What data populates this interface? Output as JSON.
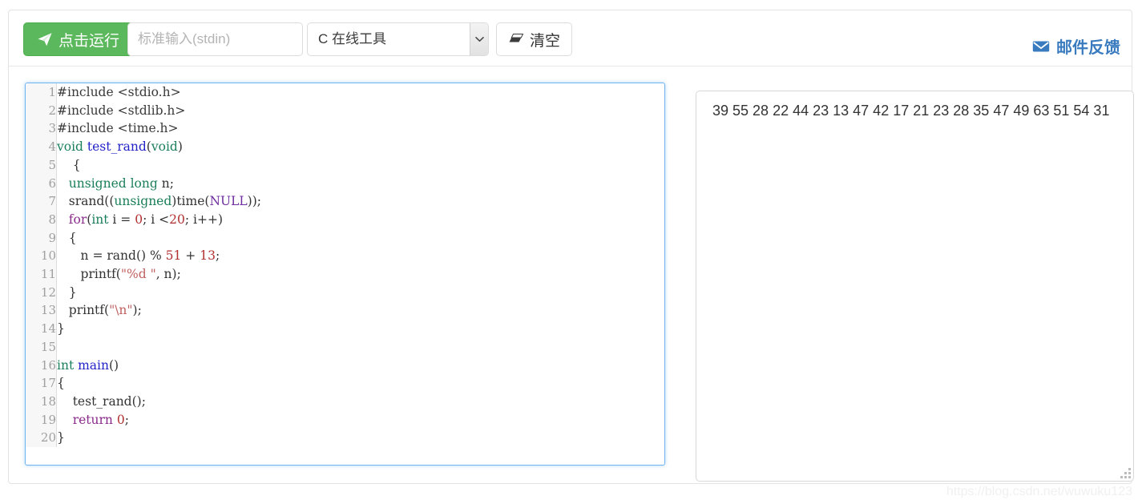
{
  "toolbar": {
    "run_label": "点击运行",
    "run_icon": "paper-plane-icon",
    "run_color": "#5cb85c",
    "stdin_placeholder": "标准输入(stdin)",
    "stdin_value": "",
    "language_selected": "C 在线工具",
    "language_options": [
      "C 在线工具"
    ],
    "clear_label": "清空",
    "clear_icon": "eraser-icon",
    "feedback_label": "邮件反馈",
    "feedback_icon": "envelope-icon",
    "feedback_color": "#3a7bbf"
  },
  "editor": {
    "focus_border_color": "#72b4ef",
    "lines": [
      {
        "n": "1",
        "tokens": [
          {
            "t": "#include ",
            "c": "tok-pre"
          },
          {
            "t": "<stdio.h>",
            "c": "tok-inc"
          }
        ]
      },
      {
        "n": "2",
        "tokens": [
          {
            "t": "#include ",
            "c": "tok-pre"
          },
          {
            "t": "<stdlib.h>",
            "c": "tok-inc"
          }
        ]
      },
      {
        "n": "3",
        "tokens": [
          {
            "t": "#include ",
            "c": "tok-pre"
          },
          {
            "t": "<time.h>",
            "c": "tok-inc"
          }
        ]
      },
      {
        "n": "4",
        "tokens": [
          {
            "t": "void ",
            "c": "tok-type"
          },
          {
            "t": "test_rand",
            "c": "tok-fn"
          },
          {
            "t": "(",
            "c": "tok-plain"
          },
          {
            "t": "void",
            "c": "tok-type"
          },
          {
            "t": ")",
            "c": "tok-plain"
          }
        ]
      },
      {
        "n": "5",
        "tokens": [
          {
            "t": "    {",
            "c": "tok-plain"
          }
        ]
      },
      {
        "n": "6",
        "tokens": [
          {
            "t": "   ",
            "c": "tok-plain"
          },
          {
            "t": "unsigned long",
            "c": "tok-type"
          },
          {
            "t": " n;",
            "c": "tok-plain"
          }
        ]
      },
      {
        "n": "7",
        "tokens": [
          {
            "t": "   srand((",
            "c": "tok-plain"
          },
          {
            "t": "unsigned",
            "c": "tok-type"
          },
          {
            "t": ")time(",
            "c": "tok-plain"
          },
          {
            "t": "NULL",
            "c": "tok-const"
          },
          {
            "t": "));",
            "c": "tok-plain"
          }
        ]
      },
      {
        "n": "8",
        "tokens": [
          {
            "t": "   ",
            "c": "tok-plain"
          },
          {
            "t": "for",
            "c": "tok-kw"
          },
          {
            "t": "(",
            "c": "tok-plain"
          },
          {
            "t": "int",
            "c": "tok-type"
          },
          {
            "t": " i = ",
            "c": "tok-plain"
          },
          {
            "t": "0",
            "c": "tok-num"
          },
          {
            "t": "; i <",
            "c": "tok-plain"
          },
          {
            "t": "20",
            "c": "tok-num"
          },
          {
            "t": "; i++)",
            "c": "tok-plain"
          }
        ]
      },
      {
        "n": "9",
        "tokens": [
          {
            "t": "   {",
            "c": "tok-plain"
          }
        ]
      },
      {
        "n": "10",
        "tokens": [
          {
            "t": "      n = rand() % ",
            "c": "tok-plain"
          },
          {
            "t": "51",
            "c": "tok-num"
          },
          {
            "t": " + ",
            "c": "tok-plain"
          },
          {
            "t": "13",
            "c": "tok-num"
          },
          {
            "t": ";",
            "c": "tok-plain"
          }
        ]
      },
      {
        "n": "11",
        "tokens": [
          {
            "t": "      printf(",
            "c": "tok-plain"
          },
          {
            "t": "\"%d \"",
            "c": "tok-str"
          },
          {
            "t": ", n);",
            "c": "tok-plain"
          }
        ]
      },
      {
        "n": "12",
        "tokens": [
          {
            "t": "   }",
            "c": "tok-plain"
          }
        ]
      },
      {
        "n": "13",
        "tokens": [
          {
            "t": "   printf(",
            "c": "tok-plain"
          },
          {
            "t": "\"\\n\"",
            "c": "tok-str"
          },
          {
            "t": ");",
            "c": "tok-plain"
          }
        ]
      },
      {
        "n": "14",
        "tokens": [
          {
            "t": "}",
            "c": "tok-plain"
          }
        ]
      },
      {
        "n": "15",
        "tokens": [
          {
            "t": "",
            "c": "tok-plain"
          }
        ]
      },
      {
        "n": "16",
        "tokens": [
          {
            "t": "int ",
            "c": "tok-type"
          },
          {
            "t": "main",
            "c": "tok-fn"
          },
          {
            "t": "()",
            "c": "tok-plain"
          }
        ]
      },
      {
        "n": "17",
        "tokens": [
          {
            "t": "{",
            "c": "tok-plain"
          }
        ]
      },
      {
        "n": "18",
        "tokens": [
          {
            "t": "    test_rand();",
            "c": "tok-plain"
          }
        ]
      },
      {
        "n": "19",
        "tokens": [
          {
            "t": "    ",
            "c": "tok-plain"
          },
          {
            "t": "return",
            "c": "tok-kw"
          },
          {
            "t": " ",
            "c": "tok-plain"
          },
          {
            "t": "0",
            "c": "tok-num"
          },
          {
            "t": ";",
            "c": "tok-plain"
          }
        ]
      },
      {
        "n": "20",
        "tokens": [
          {
            "t": "}",
            "c": "tok-plain"
          }
        ]
      }
    ]
  },
  "output": {
    "text": "39 55 28 22 44 23 13 47 42 17 21 23 28 35 47 49 63 51 54 31",
    "values": [
      39,
      55,
      28,
      22,
      44,
      23,
      13,
      47,
      42,
      17,
      21,
      23,
      28,
      35,
      47,
      49,
      63,
      51,
      54,
      31
    ]
  },
  "watermark": {
    "text": "https://blog.csdn.net/wuwuku123"
  }
}
